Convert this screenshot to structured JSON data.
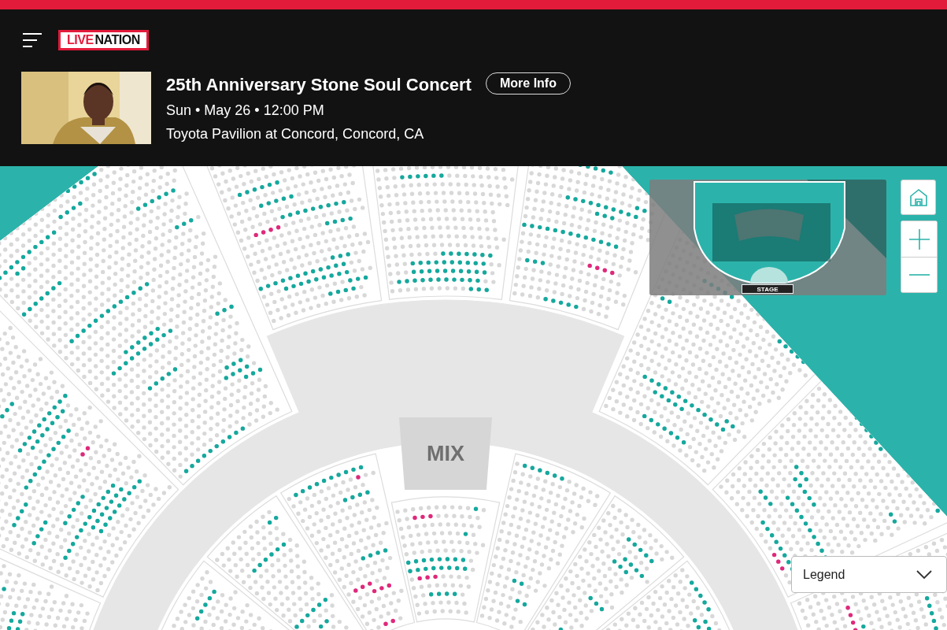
{
  "header": {
    "logo": {
      "words": [
        "LIVE",
        "NATION"
      ]
    },
    "event": {
      "title": "25th Anniversary Stone Soul Concert",
      "date": "Sun • May 26 • 12:00 PM",
      "venue": "Toyota Pavilion at Concord, Concord, CA"
    },
    "more_info_button": "More Info"
  },
  "seat_map": {
    "mix_label": "MIX",
    "minimap": {
      "stage_label": "STAGE"
    },
    "legend": {
      "label": "Legend",
      "expanded": false
    }
  }
}
